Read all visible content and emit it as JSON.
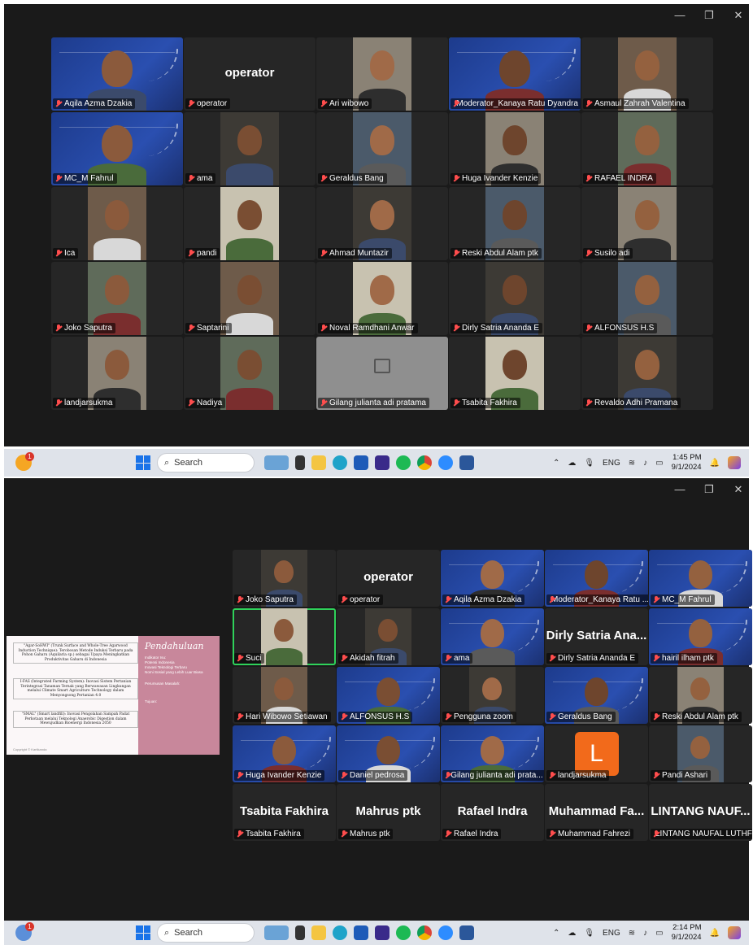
{
  "top": {
    "tiles": [
      {
        "name": "Aqila Azma Dzakia",
        "type": "banner"
      },
      {
        "name": "operator",
        "type": "name",
        "big": "operator"
      },
      {
        "name": "Ari wibowo",
        "type": "video"
      },
      {
        "name": "Moderator_Kanaya Ratu Dyandra",
        "type": "banner",
        "active": true
      },
      {
        "name": "Asmaul Zahrah Valentina",
        "type": "video"
      },
      {
        "name": "MC_M Fahrul",
        "type": "banner"
      },
      {
        "name": "ama",
        "type": "video"
      },
      {
        "name": "Geraldus Bang",
        "type": "video"
      },
      {
        "name": "Huga Ivander Kenzie",
        "type": "video"
      },
      {
        "name": "RAFAEL INDRA",
        "type": "video"
      },
      {
        "name": "Ica",
        "type": "video"
      },
      {
        "name": "pandi",
        "type": "video"
      },
      {
        "name": "Ahmad Muntazir",
        "type": "video"
      },
      {
        "name": "Reski Abdul Alam ptk",
        "type": "video"
      },
      {
        "name": "Susilo adi",
        "type": "video"
      },
      {
        "name": "Joko Saputra",
        "type": "video"
      },
      {
        "name": "Saptarini",
        "type": "video"
      },
      {
        "name": "Noval Ramdhani Anwar",
        "type": "video"
      },
      {
        "name": "Dirly Satria Ananda E",
        "type": "video"
      },
      {
        "name": "ALFONSUS H.S",
        "type": "video"
      },
      {
        "name": "landjarsukma",
        "type": "video"
      },
      {
        "name": "Nadiya",
        "type": "video"
      },
      {
        "name": "Gilang julianta adi pratama",
        "type": "placeholder"
      },
      {
        "name": "Tsabita Fakhira",
        "type": "video"
      },
      {
        "name": "Revaldo Adhi Pramana",
        "type": "video"
      }
    ],
    "taskbar": {
      "search": "Search",
      "lang": "ENG",
      "time": "1:45 PM",
      "date": "9/1/2024"
    }
  },
  "bottom": {
    "slide": {
      "heading": "Pendahuluan",
      "items": [
        "\"Agar-SoHWI\" (Trunk Surface and Whole-Tree Agarwood Induction Technique): Terobosan Metode Induksi Terbaru pada Pohon Gaharu (Aquilaria sp.) sebagai Upaya Meningkatkan Produktivitas Gaharu di Indonesia",
        "I-FAS (Integrated Farming System): Inovasi Sistem Pertanian Terintegrasi Tanaman Ternak yang Berwawasan Lingkungan melalui Climate Smart Agriculture Technology dalam Menyongsong Pertanian 4.0",
        "\"SMAL\" (Smart landfill): Inovasi Pengolahan Sampah Padat Perkotaan melalui Teknologi Anaerobic Digestion dalam Mewujudkan Bioenergi Indonesia 2050"
      ],
      "side": [
        "Indikator Isu:",
        "Potensi Indonesia",
        "Inovasi Teknologi Terbaru",
        "Nomi Sosial yang Lebih Luar Biasa",
        "Perumusan Masalah:",
        "Tujuan:"
      ],
      "footer": "Copyright © Kartikanda"
    },
    "tiles": [
      {
        "name": "Joko Saputra",
        "type": "video"
      },
      {
        "name": "operator",
        "type": "name",
        "big": "operator"
      },
      {
        "name": "Aqila Azma Dzakia",
        "type": "banner"
      },
      {
        "name": "Moderator_Kanaya Ratu ...",
        "type": "banner"
      },
      {
        "name": "MC_M Fahrul",
        "type": "banner"
      },
      {
        "name": "Suci",
        "type": "video",
        "active": true
      },
      {
        "name": "Akidah fitrah",
        "type": "video"
      },
      {
        "name": "ama",
        "type": "banner"
      },
      {
        "name": "Dirly Satria Ananda E",
        "type": "name",
        "big": "Dirly Satria Ana..."
      },
      {
        "name": "hairil ilham ptk",
        "type": "banner"
      },
      {
        "name": "Hari Wibowo Setiawan",
        "type": "video"
      },
      {
        "name": "ALFONSUS H.S",
        "type": "banner"
      },
      {
        "name": "Pengguna zoom",
        "type": "video"
      },
      {
        "name": "Geraldus Bang",
        "type": "banner"
      },
      {
        "name": "Reski Abdul Alam ptk",
        "type": "video"
      },
      {
        "name": "Huga Ivander Kenzie",
        "type": "banner"
      },
      {
        "name": "Daniel pedrosa",
        "type": "banner"
      },
      {
        "name": "Gilang julianta adi prata...",
        "type": "banner"
      },
      {
        "name": "landjarsukma",
        "type": "avatar",
        "letter": "L"
      },
      {
        "name": "Pandi Ashari",
        "type": "video"
      },
      {
        "name": "Tsabita Fakhira",
        "type": "name",
        "big": "Tsabita Fakhira"
      },
      {
        "name": "Mahrus ptk",
        "type": "name",
        "big": "Mahrus ptk"
      },
      {
        "name": "Rafael Indra",
        "type": "name",
        "big": "Rafael Indra"
      },
      {
        "name": "Muhammad Fahrezi",
        "type": "name",
        "big": "Muhammad Fa..."
      },
      {
        "name": "LINTANG NAUFAL LUTHFI",
        "type": "name",
        "big": "LINTANG NAUF..."
      }
    ],
    "taskbar": {
      "search": "Search",
      "lang": "ENG",
      "time": "2:14 PM",
      "date": "9/1/2024"
    }
  },
  "colors": {
    "zoom_bg": "#1a1a1a",
    "tile_bg": "#262626",
    "active_border": "#2fd25a",
    "muted_mic": "#ff4d4d",
    "avatar_orange": "#f26a1b"
  }
}
